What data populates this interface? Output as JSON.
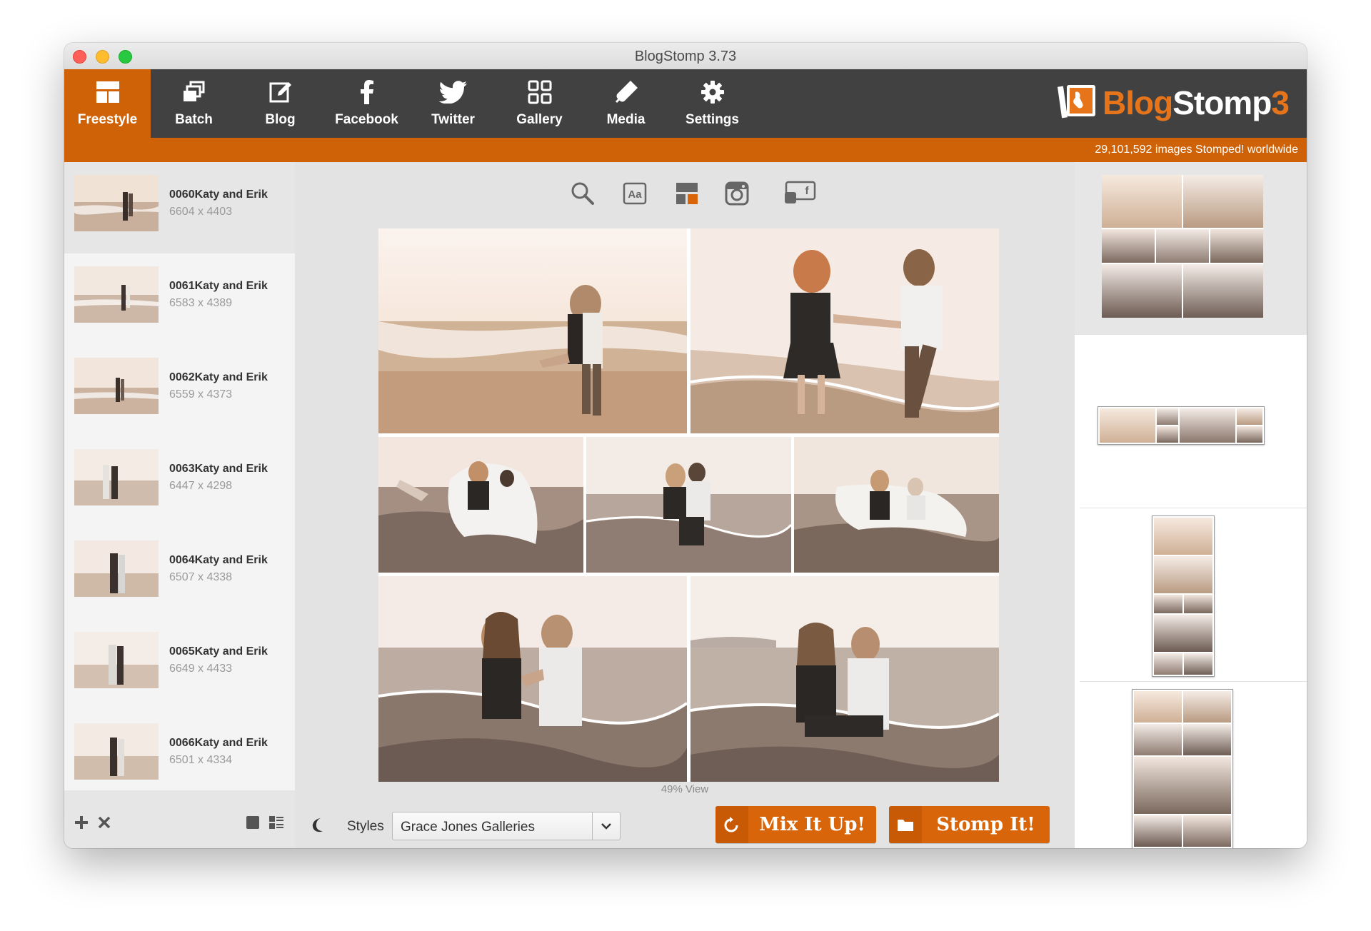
{
  "window": {
    "title": "BlogStomp 3.73"
  },
  "toolbar": {
    "items": [
      {
        "label": "Freestyle",
        "icon": "freestyle-icon",
        "active": true
      },
      {
        "label": "Batch",
        "icon": "batch-icon"
      },
      {
        "label": "Blog",
        "icon": "blog-edit-icon"
      },
      {
        "label": "Facebook",
        "icon": "facebook-icon"
      },
      {
        "label": "Twitter",
        "icon": "twitter-icon"
      },
      {
        "label": "Gallery",
        "icon": "gallery-grid-icon"
      },
      {
        "label": "Media",
        "icon": "usb-drive-icon"
      },
      {
        "label": "Settings",
        "icon": "gear-icon"
      }
    ],
    "logo": {
      "part1": "Blog",
      "part2": "Stomp",
      "part3": "3"
    },
    "stomped_text": "29,101,592 images Stomped! worldwide"
  },
  "images": [
    {
      "name": "0060Katy and Erik",
      "dims": "6604 x 4403"
    },
    {
      "name": "0061Katy and Erik",
      "dims": "6583 x 4389"
    },
    {
      "name": "0062Katy and Erik",
      "dims": "6559 x 4373"
    },
    {
      "name": "0063Katy and Erik",
      "dims": "6447 x 4298"
    },
    {
      "name": "0064Katy and Erik",
      "dims": "6507 x 4338"
    },
    {
      "name": "0065Katy and Erik",
      "dims": "6649 x 4433"
    },
    {
      "name": "0066Katy and Erik",
      "dims": "6501 x 4334"
    }
  ],
  "center": {
    "tools": [
      "search-icon",
      "text-overlay-icon",
      "layout-icon",
      "instagram-icon",
      "facebook-cover-icon"
    ],
    "view_label": "49% View",
    "styles_label": "Styles",
    "styles_value": "Grace Jones Galleries",
    "mix_button": "Mix It Up!",
    "stomp_button": "Stomp It!"
  },
  "colors": {
    "accent": "#cf6206",
    "toolbar_bg": "#414141",
    "button": "#d9650a"
  }
}
